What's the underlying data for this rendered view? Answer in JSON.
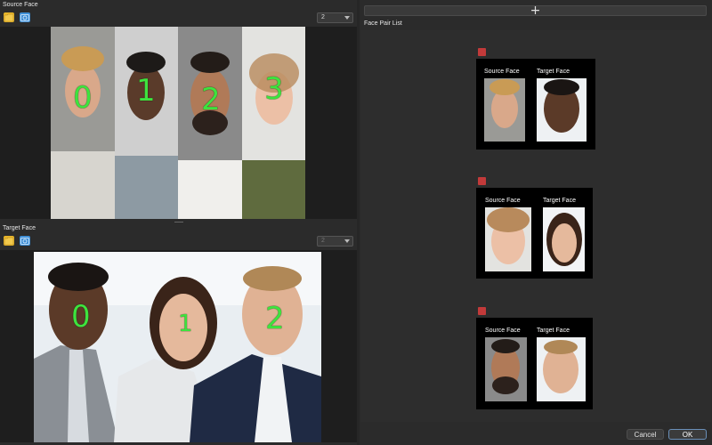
{
  "source": {
    "section_label": "Source Face",
    "selector_value": "2",
    "faces": [
      "0",
      "1",
      "2",
      "3"
    ]
  },
  "target": {
    "section_label": "Target Face",
    "selector_value": "2",
    "faces": [
      "0",
      "1",
      "2"
    ]
  },
  "right_panel": {
    "add_symbol": "+",
    "list_label": "Face Pair List",
    "pairs": [
      {
        "source_label": "Source Face",
        "target_label": "Target Face"
      },
      {
        "source_label": "Source Face",
        "target_label": "Target Face"
      },
      {
        "source_label": "Source Face",
        "target_label": "Target Face"
      }
    ]
  },
  "footer": {
    "cancel_label": "Cancel",
    "ok_label": "OK"
  },
  "colors": {
    "background": "#2b2b2b",
    "canvas": "#1e1e1e",
    "face_number": "#3ee33e",
    "delete_button": "#c23a3a",
    "folder_icon": "#e8b62a",
    "camera_icon": "#3f8fd6",
    "ok_button": "#3b3b3b"
  },
  "icons": [
    "folder-icon",
    "camera-icon",
    "chevron-down-icon",
    "plus-icon",
    "trash-icon"
  ]
}
